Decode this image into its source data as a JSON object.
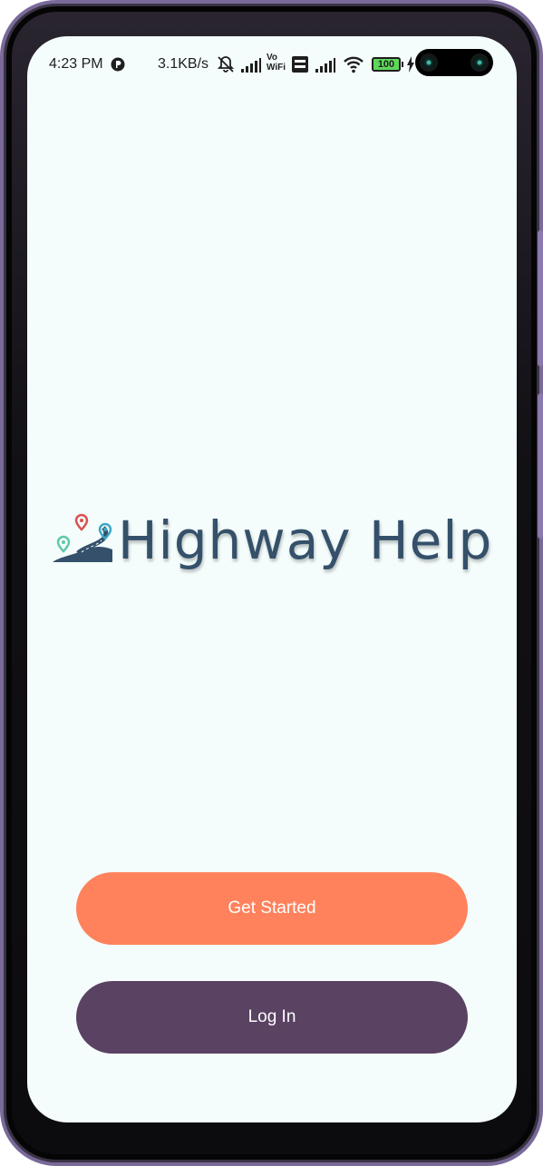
{
  "status_bar": {
    "time": "4:23 PM",
    "net_speed": "3.1KB/s",
    "vowifi_top": "Vo",
    "vowifi_bottom": "WiFi",
    "battery": "100",
    "icons": [
      "messenger-icon",
      "mute-bell-icon",
      "signal-icon",
      "vowifi-icon",
      "volte-icon",
      "signal-icon",
      "wifi-icon",
      "battery-icon",
      "charging-icon"
    ]
  },
  "logo": {
    "text": "Highway Help",
    "colors": {
      "text": "#34506a",
      "road": "#34506a",
      "pin_red": "#d9534f",
      "pin_teal": "#3aa8c9",
      "pin_green": "#5fc9a8"
    }
  },
  "actions": {
    "get_started": "Get Started",
    "log_in": "Log In"
  },
  "colors": {
    "background": "#f4fdfc",
    "get_started": "#ff825c",
    "log_in": "#5a4263"
  }
}
